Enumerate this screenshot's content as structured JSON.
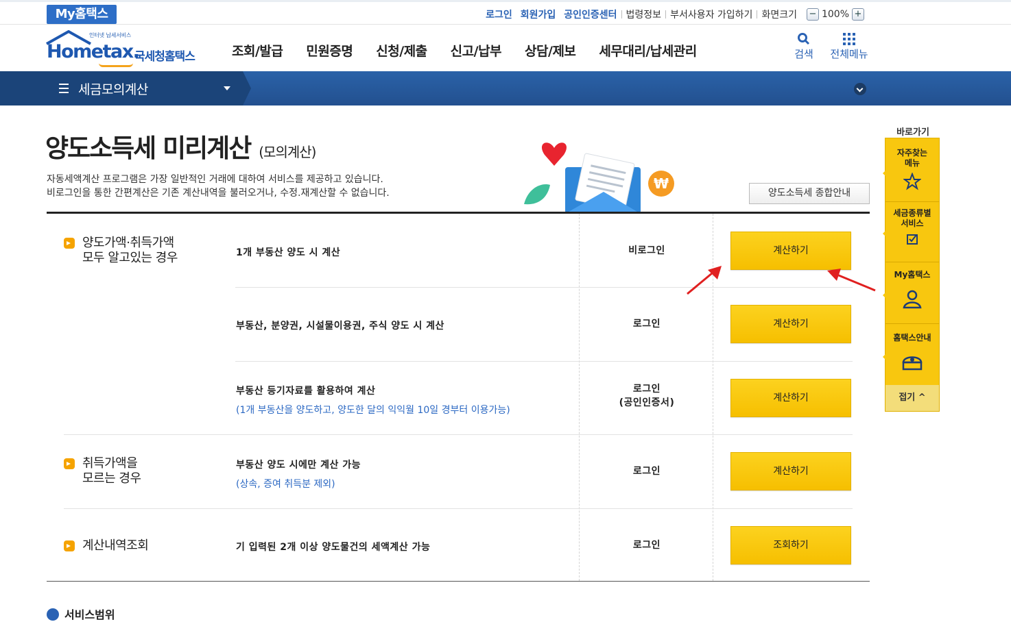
{
  "topbar": {
    "badge": "My홈택스",
    "links": [
      "로그인",
      "회원가입",
      "공인인증센터",
      "법령정보",
      "부서사용자 가입하기",
      "화면크기"
    ],
    "zoom": "100%"
  },
  "header": {
    "logo_small": "인터넷 납세서비스",
    "logo_main": "Hometax.",
    "logo_sub": "국세청홈택스",
    "nav": [
      "조회/발급",
      "민원증명",
      "신청/제출",
      "신고/납부",
      "상담/제보",
      "세무대리/납세관리"
    ],
    "search_label": "검색",
    "menu_label": "전체메뉴"
  },
  "subnav": {
    "title": "세금모의계산"
  },
  "page": {
    "title": "양도소득세 미리계산",
    "title_note": "(모의계산)",
    "desc_line1": "자동세액계산 프로그램은 가장 일반적인 거래에 대하여 서비스를 제공하고 있습니다.",
    "desc_line2": "비로그인을 통한 간편계산은 기존 계산내역을 불러오거나, 수정.재계산할 수 없습니다.",
    "guide_button": "양도소득세 종합안내"
  },
  "table": {
    "groups": [
      {
        "cat_line1": "양도가액·취득가액",
        "cat_line2": "모두 알고있는 경우"
      },
      {
        "cat_line1": "취득가액을",
        "cat_line2": "모르는 경우"
      },
      {
        "cat_line1": "계산내역조회",
        "cat_line2": ""
      }
    ],
    "rows": [
      {
        "desc": "1개 부동산 양도 시 계산",
        "sub": "",
        "auth": "비로그인",
        "auth2": "",
        "button": "계산하기"
      },
      {
        "desc": "부동산, 분양권, 시설물이용권, 주식 양도 시 계산",
        "sub": "",
        "auth": "로그인",
        "auth2": "",
        "button": "계산하기"
      },
      {
        "desc": "부동산 등기자료를 활용하여 계산",
        "sub": "(1개 부동산을 양도하고, 양도한 달의 익익월 10일 경부터 이용가능)",
        "auth": "로그인",
        "auth2": "(공인인증서)",
        "button": "계산하기"
      },
      {
        "desc": "부동산 양도 시에만 계산 가능",
        "sub": "(상속, 증여 취득분 제외)",
        "auth": "로그인",
        "auth2": "",
        "button": "계산하기"
      },
      {
        "desc": "기 입력된 2개 이상 양도물건의 세액계산 가능",
        "sub": "",
        "auth": "로그인",
        "auth2": "",
        "button": "조회하기"
      }
    ]
  },
  "quick_menu": {
    "label": "바로가기",
    "items": [
      {
        "line1": "자주찾는",
        "line2": "메뉴",
        "icon": "star-icon"
      },
      {
        "line1": "세금종류별",
        "line2": "서비스",
        "icon": "checkbox-icon"
      },
      {
        "line1": "My홈택스",
        "line2": "",
        "icon": "user-icon"
      },
      {
        "line1": "홈택스안내",
        "line2": "",
        "icon": "guide-icon"
      }
    ],
    "fold": "접기 ^"
  },
  "footer_hint": "서비스범위",
  "colors": {
    "brand_blue": "#2d6ec7",
    "nav_dark": "#1b4479",
    "button_yellow": "#f8c70f",
    "annotation_red": "#e02020"
  }
}
